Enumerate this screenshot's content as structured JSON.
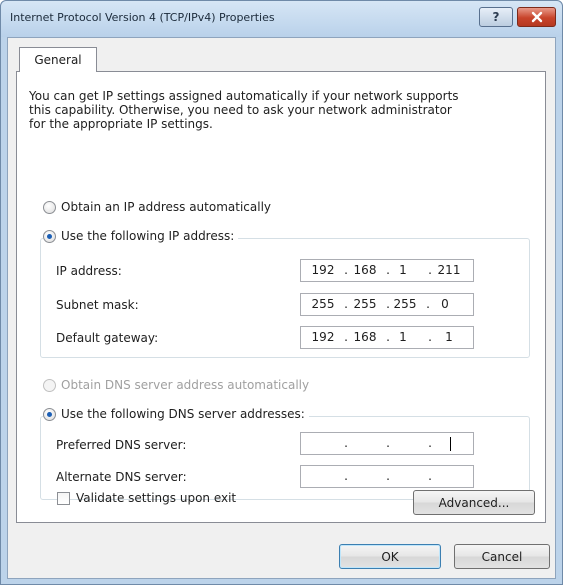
{
  "window": {
    "title": "Internet Protocol Version 4 (TCP/IPv4) Properties",
    "help_glyph": "?",
    "close_color": "#c8442b"
  },
  "tabs": [
    {
      "label": "General",
      "selected": true
    }
  ],
  "general": {
    "description": "You can get IP settings assigned automatically if your network supports\nthis capability. Otherwise, you need to ask your network administrator\nfor the appropriate IP settings.",
    "ip_mode": {
      "auto_label": "Obtain an IP address automatically",
      "manual_label": "Use the following IP address:",
      "selected": "manual"
    },
    "ip_address": {
      "label": "IP address:",
      "octets": [
        "192",
        "168",
        "1",
        "211"
      ]
    },
    "subnet_mask": {
      "label": "Subnet mask:",
      "octets": [
        "255",
        "255",
        "255",
        "0"
      ]
    },
    "default_gateway": {
      "label": "Default gateway:",
      "octets": [
        "192",
        "168",
        "1",
        "1"
      ]
    },
    "dns_mode": {
      "auto_label": "Obtain DNS server address automatically",
      "manual_label": "Use the following DNS server addresses:",
      "selected": "manual",
      "auto_disabled": true
    },
    "preferred_dns": {
      "label": "Preferred DNS server:",
      "octets": [
        "",
        "",
        "",
        ""
      ]
    },
    "alternate_dns": {
      "label": "Alternate DNS server:",
      "octets": [
        "",
        "",
        "",
        ""
      ]
    },
    "validate": {
      "label": "Validate settings upon exit",
      "checked": false
    },
    "advanced_label": "Advanced..."
  },
  "buttons": {
    "ok": "OK",
    "cancel": "Cancel"
  }
}
